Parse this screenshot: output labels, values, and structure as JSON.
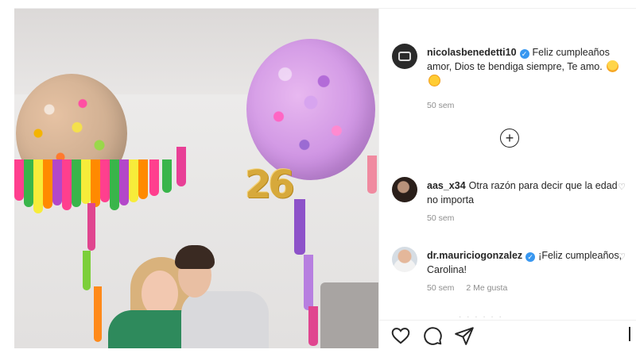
{
  "post": {
    "comments": [
      {
        "username": "nicolasbenedetti10",
        "verified": true,
        "text": "Feliz cumpleaños amor, Dios te bendiga siempre, Te amo.",
        "time": "50 sem"
      },
      {
        "username": "aas_x34",
        "verified": false,
        "text": "Otra razón para decir que la edad no importa",
        "time": "50 sem"
      },
      {
        "username": "dr.mauriciogonzalez",
        "verified": true,
        "text": "¡Feliz cumpleaños, Carolina!",
        "time": "50 sem",
        "likes": "2 Me gusta"
      }
    ],
    "photo": {
      "balloon_number": "26"
    }
  },
  "icons": {
    "add": "plus-circle-icon",
    "like": "heart-icon",
    "comment": "comment-icon",
    "share": "send-icon",
    "comment_like": "heart-small-icon"
  },
  "colors": {
    "verified_badge": "#3897f0",
    "meta_text": "#8e8e8e",
    "text": "#262626"
  }
}
